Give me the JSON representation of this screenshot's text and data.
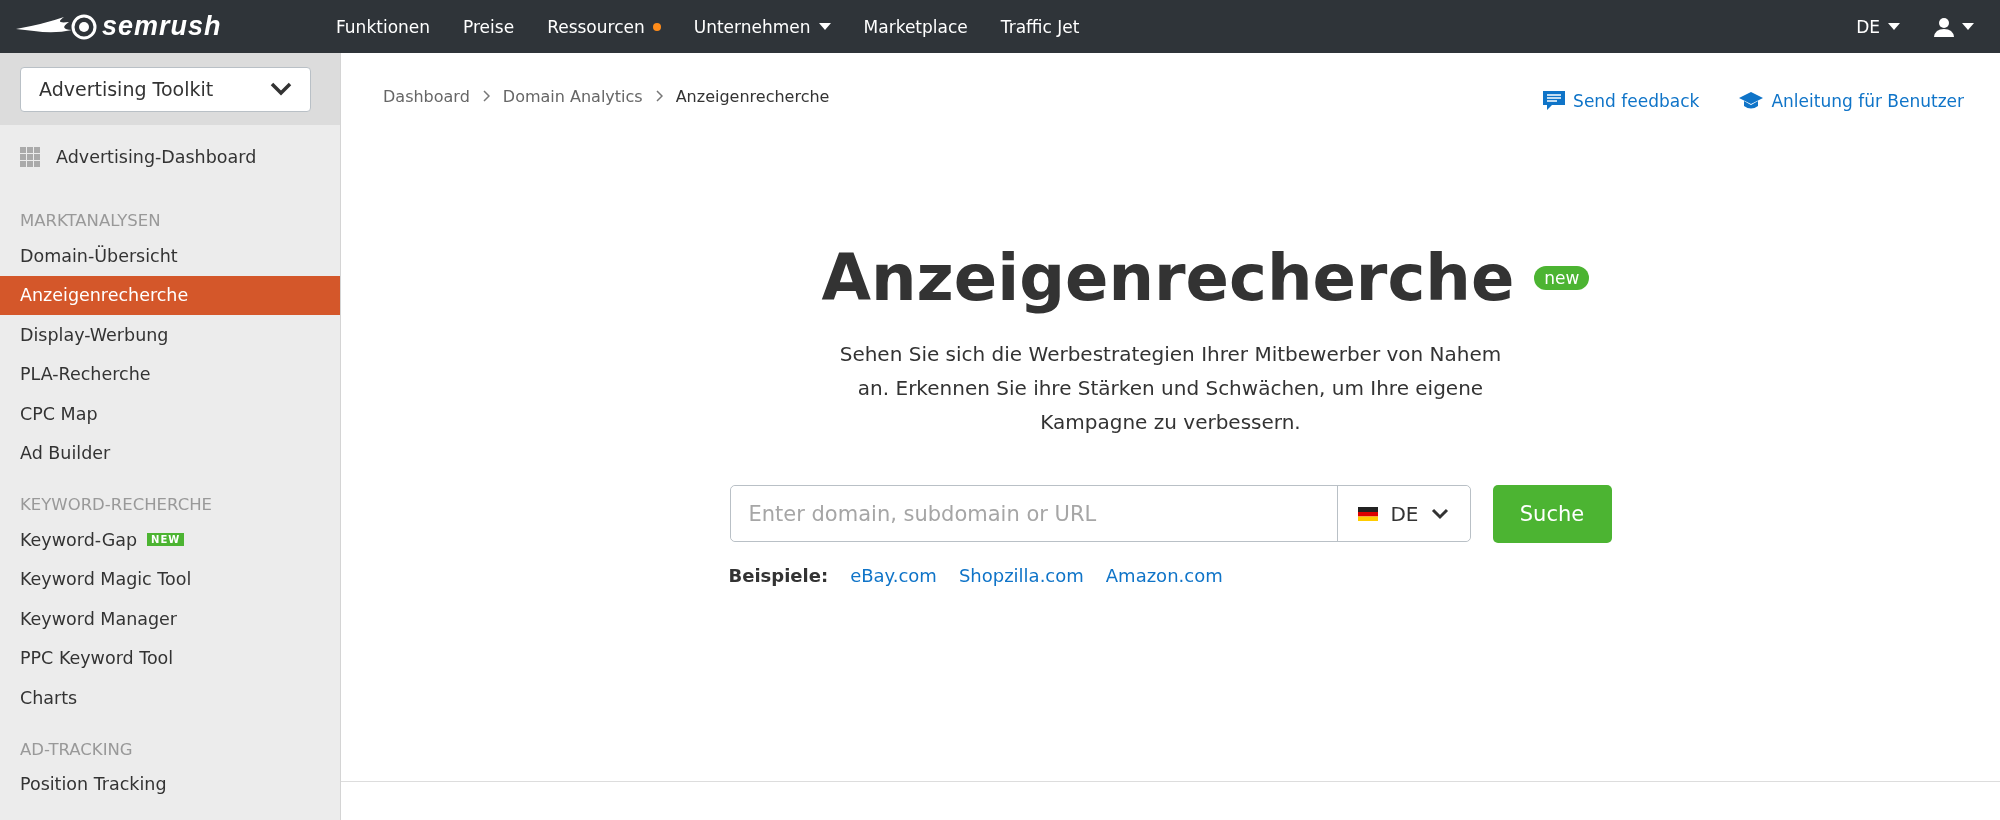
{
  "topbar": {
    "logo": "semrush",
    "nav": [
      {
        "label": "Funktionen",
        "dot": false,
        "dropdown": false
      },
      {
        "label": "Preise",
        "dot": false,
        "dropdown": false
      },
      {
        "label": "Ressourcen",
        "dot": true,
        "dropdown": false
      },
      {
        "label": "Unternehmen",
        "dot": false,
        "dropdown": true
      },
      {
        "label": "Marketplace",
        "dot": false,
        "dropdown": false
      },
      {
        "label": "Traffic Jet",
        "dot": false,
        "dropdown": false
      }
    ],
    "language": "DE"
  },
  "sidebar": {
    "toolkit": "Advertising Toolkit",
    "dashboard": "Advertising-Dashboard",
    "sections": [
      {
        "title": "MARKTANALYSEN",
        "items": [
          {
            "label": "Domain-Übersicht",
            "selected": false
          },
          {
            "label": "Anzeigenrecherche",
            "selected": true
          },
          {
            "label": "Display-Werbung",
            "selected": false
          },
          {
            "label": "PLA-Recherche",
            "selected": false
          },
          {
            "label": "CPC Map",
            "selected": false
          },
          {
            "label": "Ad Builder",
            "selected": false
          }
        ]
      },
      {
        "title": "KEYWORD-RECHERCHE",
        "items": [
          {
            "label": "Keyword-Gap",
            "selected": false,
            "badge": "NEW"
          },
          {
            "label": "Keyword Magic Tool",
            "selected": false
          },
          {
            "label": "Keyword Manager",
            "selected": false
          },
          {
            "label": "PPC Keyword Tool",
            "selected": false
          },
          {
            "label": "Charts",
            "selected": false
          }
        ]
      },
      {
        "title": "AD-TRACKING",
        "items": [
          {
            "label": "Position Tracking",
            "selected": false
          }
        ]
      }
    ]
  },
  "breadcrumb": [
    "Dashboard",
    "Domain Analytics",
    "Anzeigenrecherche"
  ],
  "header_links": [
    "Send feedback",
    "Anleitung für Benutzer"
  ],
  "hero": {
    "title": "Anzeigenrecherche",
    "badge": "new",
    "description": "Sehen Sie sich die Werbestrategien Ihrer Mitbewerber von Nahem an. Erkennen Sie ihre Stärken und Schwächen, um Ihre eigene Kampagne zu verbessern."
  },
  "search": {
    "placeholder": "Enter domain, subdomain or URL",
    "country": "DE",
    "button": "Suche"
  },
  "examples": {
    "label": "Beispiele:",
    "links": [
      "eBay.com",
      "Shopzilla.com",
      "Amazon.com"
    ]
  }
}
